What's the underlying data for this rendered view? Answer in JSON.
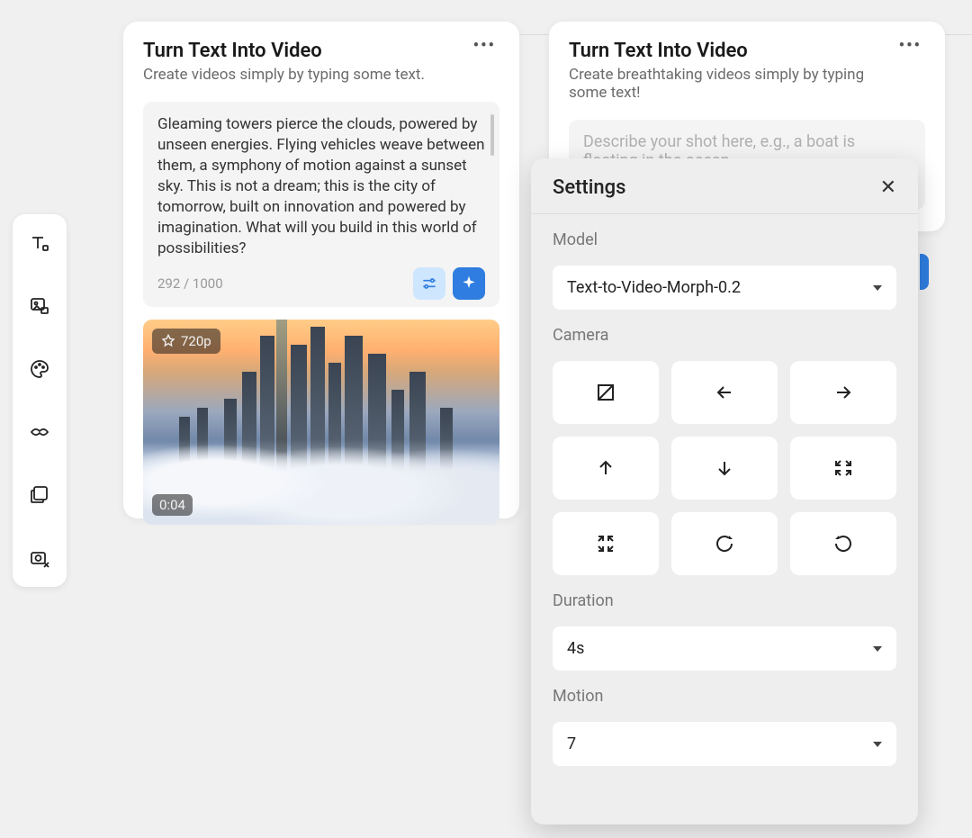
{
  "left_card": {
    "title": "Turn Text Into Video",
    "subtitle": "Create videos simply by typing some text.",
    "prompt_text": "Gleaming towers pierce the clouds, powered by unseen energies. Flying vehicles weave between them, a symphony of motion against a sunset sky. This is not a dream; this is the city of tomorrow, built on innovation and powered by imagination. What will you build in this world of possibilities?",
    "char_count": "292 / 1000",
    "resolution_badge": "720p",
    "duration_badge": "0:04"
  },
  "right_card": {
    "title": "Turn Text Into Video",
    "subtitle": "Create breathtaking videos simply by typing some text!",
    "placeholder": "Describe your shot here, e.g., a boat is floating in the ocean."
  },
  "settings": {
    "title": "Settings",
    "model_label": "Model",
    "model_value": "Text-to-Video-Morph-0.2",
    "camera_label": "Camera",
    "duration_label": "Duration",
    "duration_value": "4s",
    "motion_label": "Motion",
    "motion_value": "7"
  }
}
